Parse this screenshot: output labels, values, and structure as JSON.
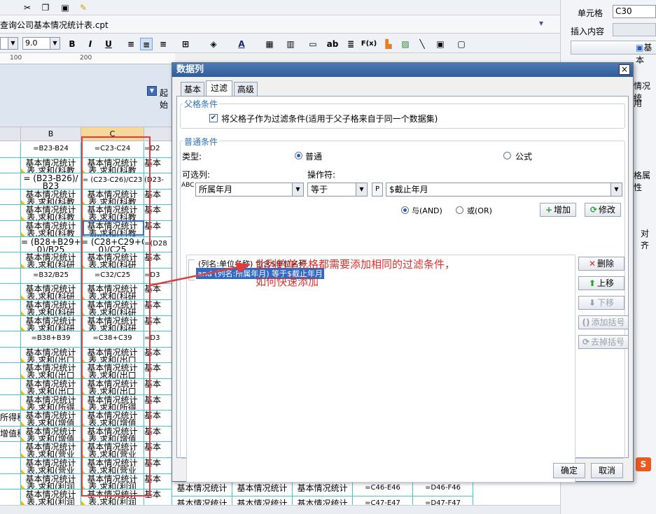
{
  "toolbar": {
    "filename": "查询公司基本情况统计表.cpt",
    "font_size": "9.0",
    "bold": "B",
    "italic": "I",
    "underline": "U",
    "text_btn": "ab",
    "formula_btn": "F(x)"
  },
  "ruler": {
    "marks": [
      "100",
      "200"
    ]
  },
  "param_row": {
    "start_label": "起始"
  },
  "grid": {
    "col_headers": [
      "B",
      "C"
    ],
    "col_b": [
      "=B23-B24",
      "基本情况统计\n表.求和(科教",
      "= (B23-B26)/\nB23",
      "基本情况统计\n表.求和(科教",
      "基本情况统计\n表.求和(科教",
      "基本情况统计\n表.求和(科教",
      "= (B28+B29+B3\n0)/B25",
      "基本情况统计\n表.求和(科研",
      "=B32/B25",
      "基本情况统计\n表.求和(科研",
      "基本情况统计\n表.求和(科研",
      "基本情况统计\n表.求和(科研",
      "=B38+B39",
      "基本情况统计\n表.求和(出口",
      "基本情况统计\n表.求和(出口",
      "基本情况统计\n表.求和(出口",
      "基本情况统计\n表.求和(所得",
      "基本情况统计\n表.求和(增值",
      "基本情况统计\n表.求和(增值",
      "基本情况统计\n表.求和(营业",
      "基本情况统计\n表.求和(营业",
      "基本情况统计\n表.求和(利润",
      "基本情况统计\n表.求和(利润",
      "基本情况统计"
    ],
    "col_c": [
      "=C23-C24",
      "基本情况统计\n表.求和(科教",
      "= (C23-C26)/C23",
      "基本情况统计\n表.求和(科教",
      "基本情况统计\n表.求和(科教",
      "基本情况统计\n表.求和(科教",
      "= (C28+C29+C3\n0)/C25",
      "基本情况统计\n表.求和(科研",
      "=C32/C25",
      "基本情况统计\n表.求和(科研",
      "基本情况统计\n表.求和(科研",
      "基本情况统计\n表.求和(科研",
      "=C38+C39",
      "基本情况统计\n表.求和(出口",
      "基本情况统计\n表.求和(出口",
      "基本情况统计\n表.求和(出口",
      "基本情况统计\n表.求和(所得",
      "基本情况统计\n表.求和(增值",
      "基本情况统计\n表.求和(增值",
      "基本情况统计\n表.求和(营业",
      "基本情况统计\n表.求和(营业",
      "基本情况统计\n表.求和(利润",
      "基本情况统计\n表.求和(利润",
      "基本情况统计"
    ],
    "col_d": [
      "=D2",
      "基本",
      "(D23-",
      "基本",
      "基本",
      "基本",
      "=(D28",
      "基本",
      "=D3",
      "基本",
      "基本",
      "基本",
      "=D3",
      "基本",
      "基本",
      "基本",
      "基本",
      "基本",
      "基本",
      "基本",
      "基本",
      "基本",
      "基本",
      "基本情况统计"
    ],
    "col_a_partial": [
      "所得税",
      "增值税"
    ],
    "bottom_row1": [
      "基本情况统计",
      "基本情况统计",
      "基本情况统计",
      "=C46-E46",
      "=D46-F46"
    ],
    "bottom_row2": [
      "基本情况统计",
      "基本情况统计",
      "基本情况统计",
      "=C47-E47",
      "=D47-F47"
    ]
  },
  "right_panel": {
    "cell_label": "单元格",
    "cell_value": "C30",
    "insert_label": "插入内容",
    "basic_btn": "基本",
    "partial1": "情况统",
    "partial2": "用",
    "partial3": "格属性",
    "partial4": "对齐"
  },
  "dialog": {
    "title": "数据列",
    "close": "×",
    "tabs": [
      "基本",
      "过滤",
      "高级"
    ],
    "parent_group": "父格条件",
    "parent_check_label": "将父格子作为过滤条件(适用于父子格来自于同一个数据集)",
    "common_group": "普通条件",
    "type_label": "类型:",
    "type_normal": "普通",
    "type_formula": "公式",
    "col_label": "可选列:",
    "op_label": "操作符:",
    "col_value": "所属年月",
    "op_value": "等于",
    "value_field": "$截止年月",
    "and_label": "与(AND)",
    "or_label": "或(OR)",
    "add_btn": "增加",
    "modify_btn": "修改",
    "delete_btn": "删除",
    "up_btn": "上移",
    "down_btn": "下移",
    "add_paren_btn": "添加括号",
    "remove_paren_btn": "去掉括号",
    "conditions": [
      "(列名:单位名称) 包含$单位名称",
      "and (列名:所属年月) 等于$截止年月"
    ],
    "ok_btn": "确定",
    "cancel_btn": "取消"
  },
  "annotation": "此列的单元格都需要添加相同的过滤条件，\n如何快速添加",
  "colors": {
    "annotation": "#e0302a",
    "grid_line": "#48c6d8",
    "selection": "#3169c6"
  }
}
